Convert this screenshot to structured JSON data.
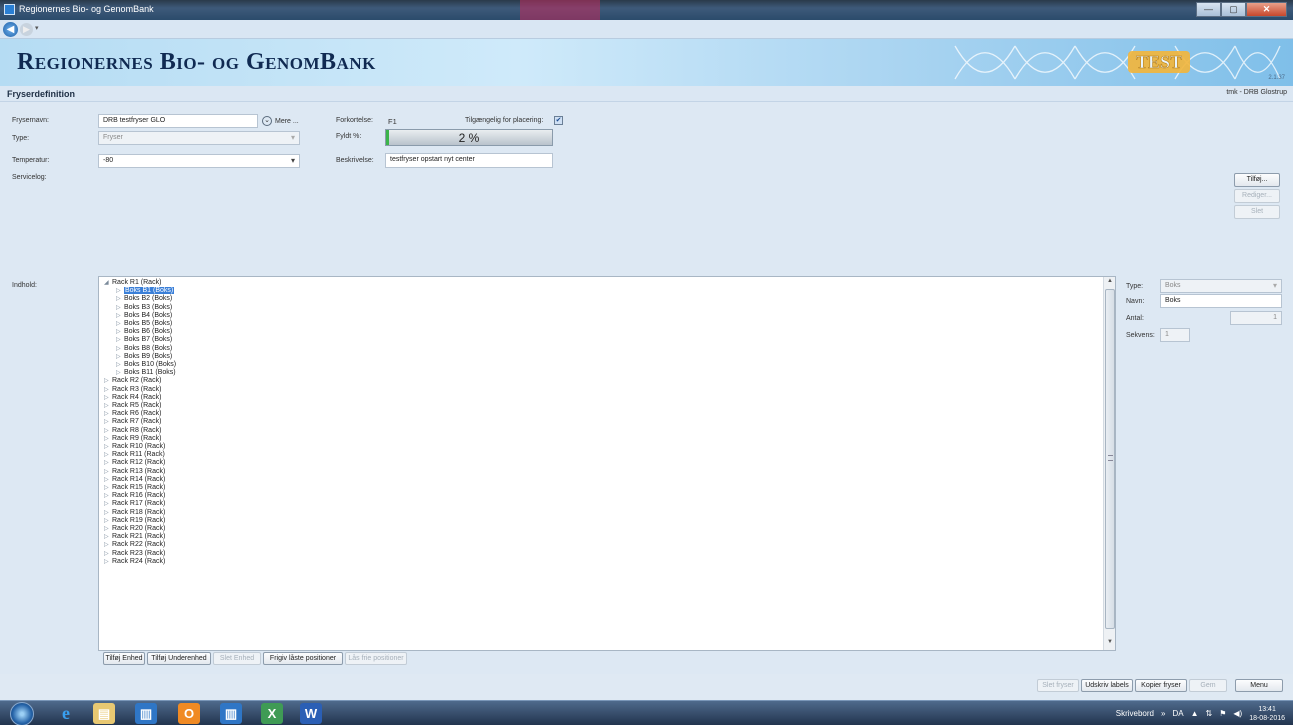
{
  "window": {
    "title": "Regionernes Bio- og GenomBank",
    "buttons": {
      "minimize": "—",
      "maximize": "▢",
      "close": "✕"
    }
  },
  "nav": {
    "back": "◀",
    "forward": "▶",
    "dropdown": "▾"
  },
  "banner": {
    "brand": "Regionernes Bio- og GenomBank",
    "watermark": "TEST",
    "version": "2.1.37"
  },
  "header": {
    "title": "Fryserdefinition",
    "user": "tmk - DRB Glostrup"
  },
  "form": {
    "frysernavn_label": "Frysernavn:",
    "frysernavn_value": "DRB testfryser GLO",
    "mere_label": "Mere ...",
    "type_label": "Type:",
    "type_value": "Fryser",
    "temperatur_label": "Temperatur:",
    "temperatur_value": "-80",
    "servicelog_label": "Servicelog:",
    "forkortelse_label": "Forkortelse:",
    "forkortelse_value": "F1",
    "tilgaengelig_label": "Tilgængelig for placering:",
    "tilgaengelig_checked": true,
    "fyldt_label": "Fyldt %:",
    "fyldt_text": "2 %",
    "fyldt_fraction": 0.02,
    "beskrivelse_label": "Beskrivelse:",
    "beskrivelse_value": "testfryser opstart nyt center",
    "indhold_label": "Indhold:"
  },
  "servicelog_buttons": {
    "add": "Tilføj...",
    "edit": "Rediger...",
    "delete": "Slet"
  },
  "tree": {
    "rows": [
      {
        "label": "Rack R1  (Rack)",
        "level": 0,
        "expanded": true
      },
      {
        "label": "Boks B1  (Boks)",
        "level": 1,
        "selected": true
      },
      {
        "label": "Boks B2  (Boks)",
        "level": 1
      },
      {
        "label": "Boks B3  (Boks)",
        "level": 1
      },
      {
        "label": "Boks B4  (Boks)",
        "level": 1
      },
      {
        "label": "Boks B5  (Boks)",
        "level": 1
      },
      {
        "label": "Boks B6  (Boks)",
        "level": 1
      },
      {
        "label": "Boks B7  (Boks)",
        "level": 1
      },
      {
        "label": "Boks B8  (Boks)",
        "level": 1
      },
      {
        "label": "Boks B9  (Boks)",
        "level": 1
      },
      {
        "label": "Boks B10  (Boks)",
        "level": 1
      },
      {
        "label": "Boks B11  (Boks)",
        "level": 1
      },
      {
        "label": "Rack R2  (Rack)",
        "level": 0
      },
      {
        "label": "Rack R3  (Rack)",
        "level": 0
      },
      {
        "label": "Rack R4  (Rack)",
        "level": 0
      },
      {
        "label": "Rack R5  (Rack)",
        "level": 0
      },
      {
        "label": "Rack R6  (Rack)",
        "level": 0
      },
      {
        "label": "Rack R7  (Rack)",
        "level": 0
      },
      {
        "label": "Rack R8  (Rack)",
        "level": 0
      },
      {
        "label": "Rack R9  (Rack)",
        "level": 0
      },
      {
        "label": "Rack R10  (Rack)",
        "level": 0
      },
      {
        "label": "Rack R11  (Rack)",
        "level": 0
      },
      {
        "label": "Rack R12  (Rack)",
        "level": 0
      },
      {
        "label": "Rack R13  (Rack)",
        "level": 0
      },
      {
        "label": "Rack R14  (Rack)",
        "level": 0
      },
      {
        "label": "Rack R15  (Rack)",
        "level": 0
      },
      {
        "label": "Rack R16  (Rack)",
        "level": 0
      },
      {
        "label": "Rack R17  (Rack)",
        "level": 0
      },
      {
        "label": "Rack R18  (Rack)",
        "level": 0
      },
      {
        "label": "Rack R19  (Rack)",
        "level": 0
      },
      {
        "label": "Rack R20  (Rack)",
        "level": 0
      },
      {
        "label": "Rack R21  (Rack)",
        "level": 0
      },
      {
        "label": "Rack R22  (Rack)",
        "level": 0
      },
      {
        "label": "Rack R23  (Rack)",
        "level": 0
      },
      {
        "label": "Rack R24  (Rack)",
        "level": 0
      }
    ]
  },
  "tree_buttons": {
    "add_unit": "Tilføj Enhed",
    "add_subunit": "Tilføj Underenhed",
    "delete_unit": "Slet Enhed",
    "release_locked": "Frigiv låste positioner",
    "lock_free": "Lås frie positioner"
  },
  "details": {
    "type_label": "Type:",
    "type_value": "Boks",
    "navn_label": "Navn:",
    "navn_value": "Boks",
    "antal_label": "Antal:",
    "antal_value": "1",
    "sekvens_label": "Sekvens:",
    "sekvens_value": "1"
  },
  "footer": {
    "delete_freezer": "Slet fryser",
    "print_labels": "Udskriv labels",
    "copy_freezer": "Kopier fryser",
    "save": "Gem",
    "menu": "Menu"
  },
  "taskbar": {
    "desktop": "Skrivebord",
    "chevron": "»",
    "lang": "DA",
    "time": "13:41",
    "date": "18-08-2016"
  }
}
